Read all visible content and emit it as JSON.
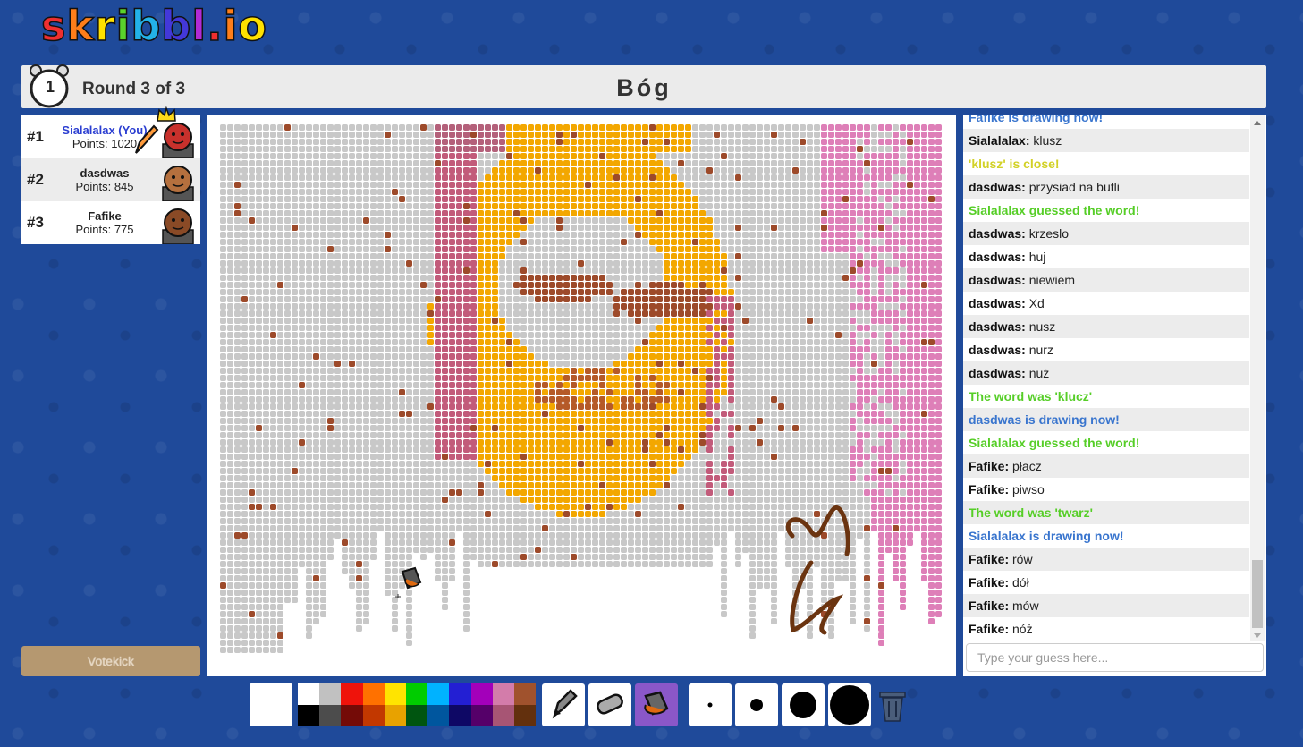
{
  "logo": {
    "text": "skribbl.io",
    "letters": [
      "s",
      "k",
      "r",
      "i",
      "b",
      "b",
      "l",
      ".",
      "i",
      "o"
    ],
    "colors": [
      "#ef2f2f",
      "#ff7e1a",
      "#ffe100",
      "#5ad22c",
      "#23b2e8",
      "#4338d9",
      "#b22bd6",
      "#ef2f2f",
      "#ff7e1a",
      "#ffe100"
    ]
  },
  "header": {
    "timer": "1",
    "round": "Round 3 of 3",
    "word": "Bóg"
  },
  "players": [
    {
      "rank": "#1",
      "name": "Sialalalax (You)",
      "points": "Points: 1020",
      "me": true,
      "avatar_color": "#c8312c"
    },
    {
      "rank": "#2",
      "name": "dasdwas",
      "points": "Points: 845",
      "me": false,
      "avatar_color": "#b5703e"
    },
    {
      "rank": "#3",
      "name": "Fafike",
      "points": "Points: 775",
      "me": false,
      "avatar_color": "#8a4a26"
    }
  ],
  "votekick_label": "Votekick",
  "chat": {
    "messages": [
      {
        "type": "blue",
        "text": "Fafike is drawing now!"
      },
      {
        "type": "user",
        "user": "Sialalalax:",
        "text": "klusz"
      },
      {
        "type": "yellow",
        "text": "'klusz' is close!"
      },
      {
        "type": "user",
        "user": "dasdwas:",
        "text": "przysiad na butli"
      },
      {
        "type": "green",
        "text": "Sialalalax guessed the word!"
      },
      {
        "type": "user",
        "user": "dasdwas:",
        "text": "krzeslo"
      },
      {
        "type": "user",
        "user": "dasdwas:",
        "text": "huj"
      },
      {
        "type": "user",
        "user": "dasdwas:",
        "text": "niewiem"
      },
      {
        "type": "user",
        "user": "dasdwas:",
        "text": "Xd"
      },
      {
        "type": "user",
        "user": "dasdwas:",
        "text": "nusz"
      },
      {
        "type": "user",
        "user": "dasdwas:",
        "text": "nurz"
      },
      {
        "type": "user",
        "user": "dasdwas:",
        "text": "nuż"
      },
      {
        "type": "green",
        "text": "The word was 'klucz'"
      },
      {
        "type": "blue",
        "text": "dasdwas is drawing now!"
      },
      {
        "type": "green",
        "text": "Sialalalax guessed the word!"
      },
      {
        "type": "user",
        "user": "Fafike:",
        "text": "płacz"
      },
      {
        "type": "user",
        "user": "Fafike:",
        "text": "piwso"
      },
      {
        "type": "green",
        "text": "The word was 'twarz'"
      },
      {
        "type": "blue",
        "text": "Sialalalax is drawing now!"
      },
      {
        "type": "user",
        "user": "Fafike:",
        "text": "rów"
      },
      {
        "type": "user",
        "user": "Fafike:",
        "text": "dół"
      },
      {
        "type": "user",
        "user": "Fafike:",
        "text": "mów"
      },
      {
        "type": "user",
        "user": "Fafike:",
        "text": "nóż"
      }
    ],
    "input_placeholder": "Type your guess here..."
  },
  "palette": {
    "top": [
      "#ffffff",
      "#c1c1c1",
      "#ef130b",
      "#ff7100",
      "#ffe400",
      "#00cc00",
      "#00b2ff",
      "#231fd3",
      "#a300ba",
      "#d37caa",
      "#a0522d"
    ],
    "bottom": [
      "#000000",
      "#4c4c4c",
      "#740b07",
      "#c23800",
      "#e8a200",
      "#005510",
      "#00569e",
      "#0e0865",
      "#550069",
      "#a75574",
      "#63300d"
    ]
  },
  "tools": [
    "pencil-icon",
    "eraser-icon",
    "fill-icon"
  ],
  "active_tool": "fill-icon",
  "brush_sizes": [
    "size-small",
    "size-medium",
    "size-large",
    "size-xlarge"
  ]
}
